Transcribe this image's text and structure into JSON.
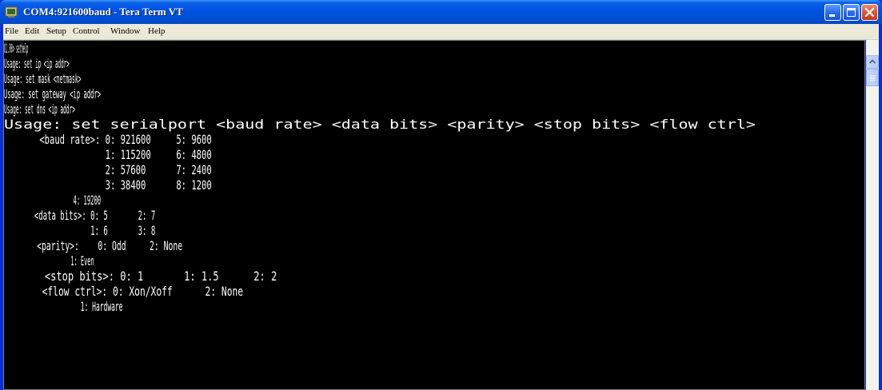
{
  "window": {
    "title": "COM4:921600baud - Tera Term VT"
  },
  "menu": [
    "File",
    "Edit",
    "Setup",
    "Control",
    "Window",
    "Help"
  ],
  "terminal": {
    "lines": [
      "U1.00> sethelp",
      "Usage: set ip <ip addr>",
      "Usage: set mask <netmask>",
      "Usage: set gateway <ip addr>",
      "Usage: set dns <ip addr>",
      "Usage: set serialport <baud rate> <data bits> <parity> <stop bits> <flow ctrl>",
      "       <baud rate>: 0: 921600     5: 9600",
      "                    1: 115200     6: 4800",
      "                    2: 57600      7: 2400",
      "                    3: 38400      8: 1200",
      "                    4: 19200",
      "       <data bits>: 0: 5       2: 7",
      "                    1: 6       3: 8",
      "       <parity>:    0: Odd     2: None",
      "                    1: Even",
      "       <stop bits>: 0: 1       1: 1.5      2: 2",
      "       <flow ctrl>: 0: Xon/Xoff      2: None",
      "                    1: Hardware"
    ]
  },
  "colors": {
    "titlebar": "#0054e3",
    "terminal_bg": "#000000",
    "terminal_fg": "#ffffff",
    "close_button": "#e0562e"
  },
  "icons": {
    "app": "tera-term-icon",
    "minimize": "minimize-icon",
    "maximize": "maximize-icon",
    "close": "close-icon",
    "scroll_up": "scroll-up-arrow-icon"
  }
}
